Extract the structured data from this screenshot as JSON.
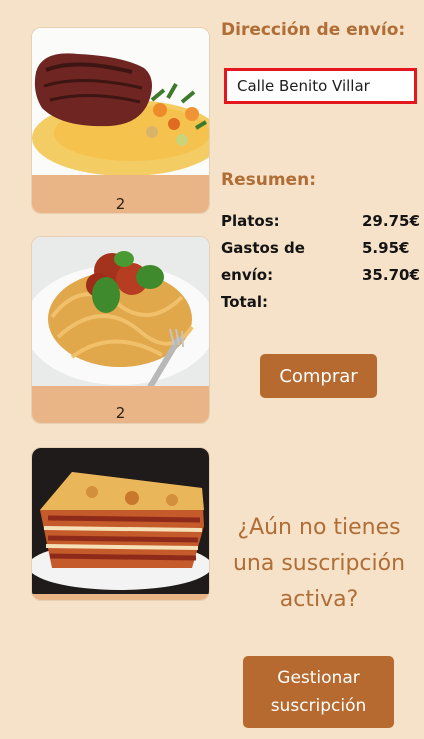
{
  "cart": {
    "items": [
      {
        "name": "steak-dish",
        "quantity": "2"
      },
      {
        "name": "spaghetti-bolognese",
        "quantity": "2"
      },
      {
        "name": "lasagna",
        "quantity": ""
      }
    ]
  },
  "shipping": {
    "title": "Dirección de envío:",
    "address_value": "Calle Benito Villar"
  },
  "summary": {
    "title": "Resumen:",
    "labels": [
      "Platos:",
      "Gastos de",
      "envío:",
      "Total:"
    ],
    "values": [
      "29.75€",
      "5.95€",
      "35.70€",
      ""
    ]
  },
  "buy_button": "Comprar",
  "promo": {
    "lines": [
      "¿Aún no tienes",
      "una suscripción",
      "activa?"
    ],
    "button_lines": [
      "Gestionar",
      "suscripción"
    ]
  },
  "colors": {
    "background": "#f6e2c8",
    "accent": "#b66a2f",
    "title": "#b06d36",
    "qty_bar": "#eab586",
    "input_border": "#e3171d"
  }
}
